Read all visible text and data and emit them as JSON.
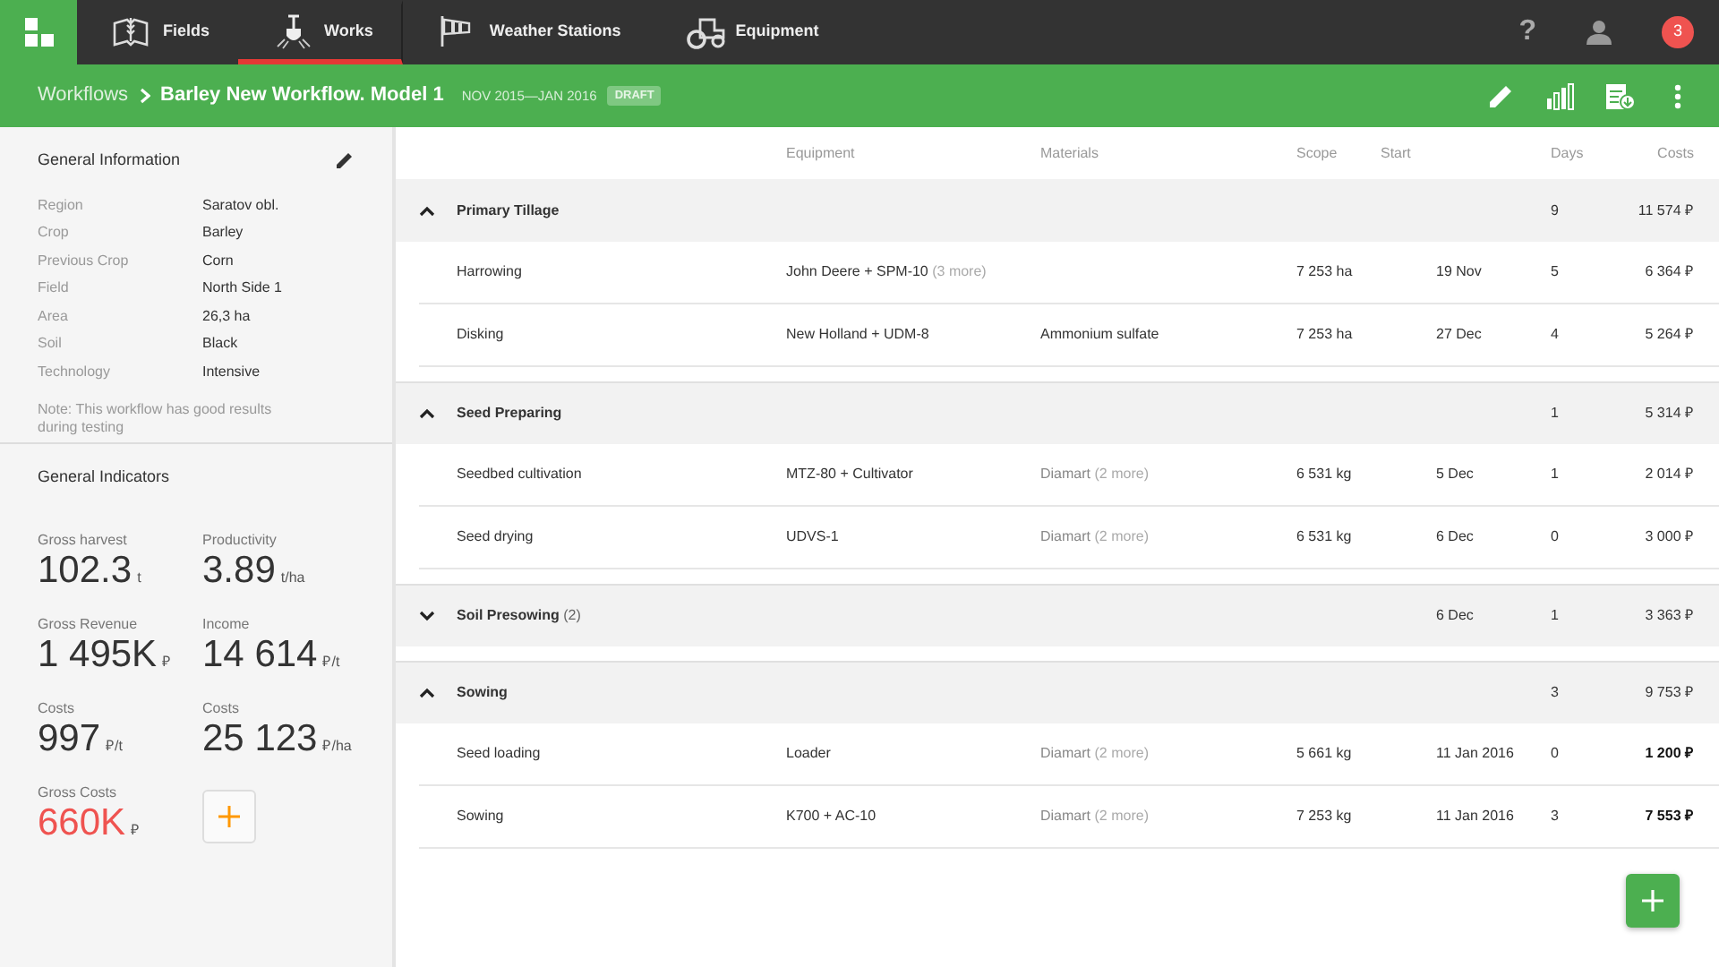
{
  "nav": {
    "tabs": [
      {
        "label": "Fields",
        "kind": "fields",
        "selected": false
      },
      {
        "label": "Works",
        "kind": "works",
        "selected": true
      },
      {
        "label": "Weather Stations",
        "kind": "weather",
        "selected": false
      },
      {
        "label": "Equipment",
        "kind": "equipment",
        "selected": false
      }
    ],
    "help": "?",
    "notifications": "3"
  },
  "header": {
    "breadcrumb": "Workflows",
    "title": "Barley New Workflow. Model 1",
    "period": "NOV 2015—JAN 2016",
    "status": "DRAFT"
  },
  "general_information": {
    "title": "General Information",
    "fields": [
      {
        "label": "Region",
        "value": "Saratov obl."
      },
      {
        "label": "Crop",
        "value": "Barley"
      },
      {
        "label": "Previous Crop",
        "value": "Corn"
      },
      {
        "label": "Field",
        "value": "North Side 1"
      },
      {
        "label": "Area",
        "value": "26,3 ha"
      },
      {
        "label": "Soil",
        "value": "Black"
      },
      {
        "label": "Technology",
        "value": "Intensive"
      }
    ],
    "note": "Note: This workflow has good results during testing"
  },
  "general_indicators": {
    "title": "General Indicators",
    "items": [
      {
        "label": "Gross harvest",
        "value": "102.3",
        "unit": "t",
        "alert": false
      },
      {
        "label": "Productivity",
        "value": "3.89",
        "unit": "t/ha",
        "alert": false
      },
      {
        "label": "Gross Revenue",
        "value": "1 495K",
        "unit": "₽",
        "alert": false
      },
      {
        "label": "Income",
        "value": "14 614",
        "unit": "₽/t",
        "alert": false
      },
      {
        "label": "Costs",
        "value": "997",
        "unit": "₽/t",
        "alert": false
      },
      {
        "label": "Costs",
        "value": "25 123",
        "unit": "₽/ha",
        "alert": false
      },
      {
        "label": "Gross Costs",
        "value": "660K",
        "unit": "₽",
        "alert": true
      }
    ]
  },
  "table": {
    "columns": [
      "Equipment",
      "Materials",
      "Scope",
      "Start",
      "Days",
      "Costs"
    ],
    "groups": [
      {
        "name": "Primary Tillage",
        "expanded": true,
        "days": "9",
        "costs": "11 574 ₽",
        "tasks": [
          {
            "name": "Harrowing",
            "equipment": "John Deere + SPM-10",
            "equipment_more": "(3 more)",
            "scope": "7 253 ha",
            "start": "19 Nov",
            "days": "5",
            "costs": "6 364 ₽",
            "emphasized": false
          },
          {
            "name": "Disking",
            "equipment": "New Holland + UDM-8",
            "materials": "Ammonium sulfate",
            "scope": "7 253 ha",
            "start": "27 Dec",
            "days": "4",
            "costs": "5 264 ₽",
            "emphasized": false
          }
        ]
      },
      {
        "name": "Seed Preparing",
        "expanded": true,
        "days": "1",
        "costs": "5 314 ₽",
        "tasks": [
          {
            "name": "Seedbed cultivation",
            "equipment": "MTZ-80 + Cultivator",
            "materials": "Diamart",
            "materials_more": "(2 more)",
            "scope": "6 531  kg",
            "start": "5 Dec",
            "days": "1",
            "costs": "2 014 ₽",
            "emphasized": false
          },
          {
            "name": "Seed drying",
            "equipment": "UDVS-1",
            "materials": "Diamart",
            "materials_more": "(2 more)",
            "scope": "6 531  kg",
            "start": "6 Dec",
            "days": "0",
            "costs": "3 000 ₽",
            "emphasized": false
          }
        ]
      },
      {
        "name": "Soil Presowing",
        "count": "(2)",
        "expanded": false,
        "start": "6 Dec",
        "days": "1",
        "costs": "3 363 ₽"
      },
      {
        "name": "Sowing",
        "expanded": true,
        "days": "3",
        "costs": "9 753 ₽",
        "tasks": [
          {
            "name": "Seed loading",
            "equipment": "Loader",
            "materials": "Diamart",
            "materials_more": "(2 more)",
            "scope": "5 661 kg",
            "start": "11 Jan 2016",
            "days": "0",
            "costs": "1 200 ₽",
            "emphasized": true
          },
          {
            "name": "Sowing",
            "equipment": "K700 + AC-10",
            "materials": "Diamart",
            "materials_more": "(2 more)",
            "scope": "7 253 kg",
            "start": "11 Jan 2016",
            "days": "3",
            "costs": "7 553 ₽",
            "emphasized": true
          }
        ]
      }
    ]
  }
}
